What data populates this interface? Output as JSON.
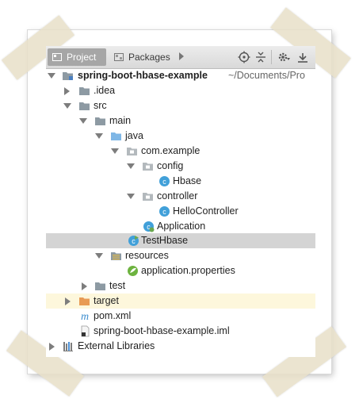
{
  "toolbar": {
    "tab_project": "Project",
    "tab_packages": "Packages",
    "icons": [
      "target-icon",
      "collapse-all-icon",
      "gear-icon",
      "hide-icon"
    ]
  },
  "tree": {
    "project_name": "spring-boot-hbase-example",
    "project_path": "~/Documents/Pro",
    "idea": ".idea",
    "src": "src",
    "main": "main",
    "java": "java",
    "package": "com.example",
    "config": "config",
    "hbase_class": "Hbase",
    "controller": "controller",
    "hello_controller": "HelloController",
    "application": "Application",
    "test_hbase": "TestHbase",
    "resources": "resources",
    "app_properties": "application.properties",
    "test": "test",
    "target": "target",
    "pom": "pom.xml",
    "iml": "spring-boot-hbase-example.iml",
    "external_libraries": "External Libraries"
  },
  "colors": {
    "folder": "#8d9aa3",
    "source_folder": "#7fb7e6",
    "excluded_folder": "#e89b55",
    "class_icon": "#41a0d9",
    "selection": "#d4d4d4",
    "excluded_row": "#fdf7dc"
  }
}
